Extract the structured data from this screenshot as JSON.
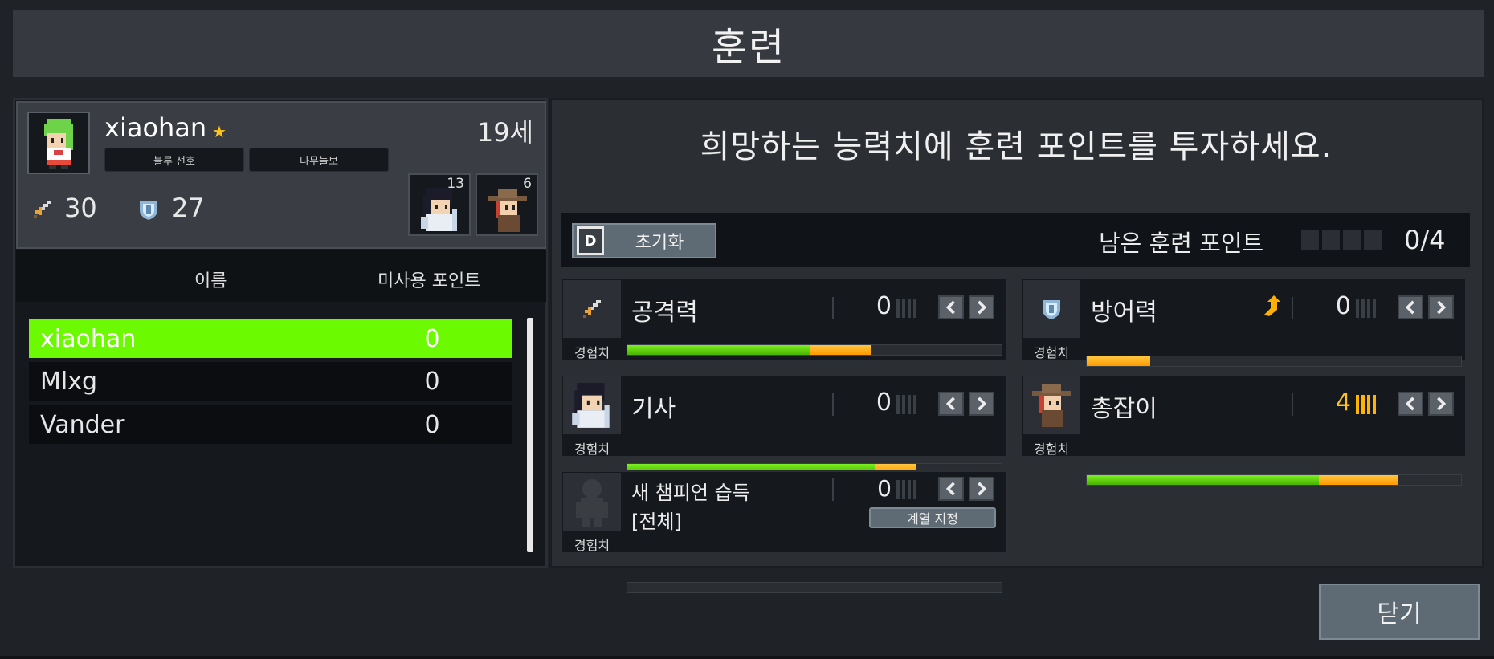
{
  "title": "훈련",
  "profile": {
    "name": "xiaohan",
    "age": "19세",
    "tags": [
      "블루 선호",
      "나무늘보"
    ],
    "attack": "30",
    "defense": "27",
    "champions": [
      {
        "icon": "knight-champion-portrait",
        "count": "13"
      },
      {
        "icon": "gunslinger-champion-portrait",
        "count": "6"
      }
    ]
  },
  "list": {
    "header_name": "이름",
    "header_points": "미사용 포인트",
    "rows": [
      {
        "name": "xiaohan",
        "points": "0",
        "selected": true
      },
      {
        "name": "Mlxg",
        "points": "0",
        "selected": false
      },
      {
        "name": "Vander",
        "points": "0",
        "selected": false
      }
    ]
  },
  "instruction": "희망하는 능력치에 훈련 포인트를 투자하세요.",
  "reset": {
    "key": "D",
    "label": "초기화"
  },
  "remaining": {
    "label": "남은 훈련 포인트",
    "value": "0/4",
    "used_fraction": 0
  },
  "exp_label": "경험치",
  "stats": {
    "attack": {
      "name": "공격력",
      "level": "0",
      "exp_green": 0.49,
      "exp_orange": 0.16
    },
    "defense": {
      "name": "방어력",
      "level": "0",
      "exp_green": 0.0,
      "exp_orange": 0.17
    },
    "knight": {
      "name": "기사",
      "level": "0",
      "exp_green": 0.66,
      "exp_orange": 0.11
    },
    "gunner": {
      "name": "총잡이",
      "level": "4",
      "exp_green": 0.62,
      "exp_orange": 0.21
    },
    "new_champion": {
      "name": "새 챔피언 습득",
      "sub": "[전체]",
      "level": "0",
      "button": "계열 지정",
      "exp_green": 0,
      "exp_orange": 0
    }
  },
  "close_label": "닫기",
  "colors": {
    "selected_row": "#6cfa00",
    "exp_green": "#55c400",
    "exp_orange": "#ffad14",
    "gold": "#ffc21a"
  }
}
